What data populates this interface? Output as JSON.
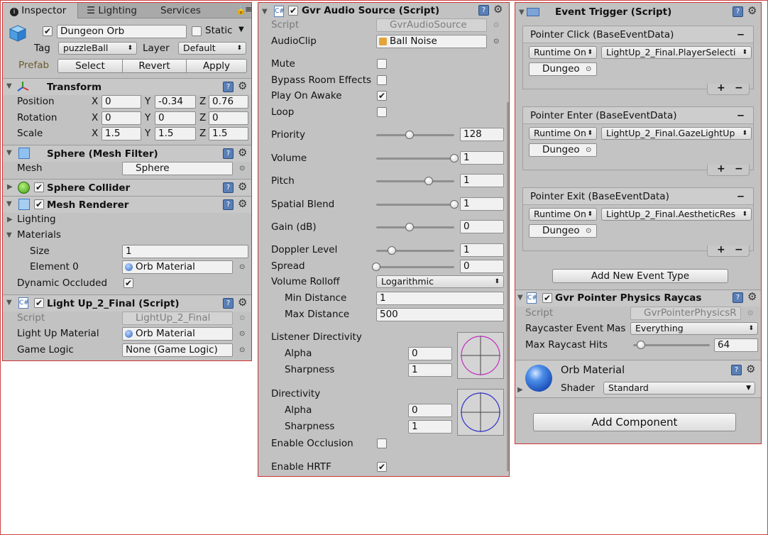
{
  "tabs": {
    "inspector": "Inspector",
    "lighting": "Lighting",
    "services": "Services"
  },
  "object": {
    "name": "Dungeon Orb",
    "static_label": "Static",
    "tag_label": "Tag",
    "tag_value": "puzzleBall",
    "layer_label": "Layer",
    "layer_value": "Default",
    "prefab_label": "Prefab",
    "select": "Select",
    "revert": "Revert",
    "apply": "Apply"
  },
  "transform": {
    "title": "Transform",
    "position": "Position",
    "rotation": "Rotation",
    "scale": "Scale",
    "pos": [
      "0",
      "-0.34",
      "0.76"
    ],
    "rot": [
      "0",
      "0",
      "0"
    ],
    "scl": [
      "1.5",
      "1.5",
      "1.5"
    ],
    "x": "X",
    "y": "Y",
    "z": "Z"
  },
  "mesh_filter": {
    "title": "Sphere (Mesh Filter)",
    "mesh_label": "Mesh",
    "mesh_value": "Sphere"
  },
  "collider": {
    "title": "Sphere Collider"
  },
  "mesh_renderer": {
    "title": "Mesh Renderer",
    "lighting": "Lighting",
    "materials": "Materials",
    "size_label": "Size",
    "size_value": "1",
    "element_label": "Element 0",
    "element_value": "Orb Material",
    "dyn_label": "Dynamic Occluded"
  },
  "lightup": {
    "title": "Light Up_2_Final (Script)",
    "script_label": "Script",
    "script_value": "LightUp_2_Final",
    "material_label": "Light Up Material",
    "material_value": "Orb Material",
    "logic_label": "Game Logic",
    "logic_value": "None (Game Logic)"
  },
  "audio": {
    "title": "Gvr Audio Source (Script)",
    "script_label": "Script",
    "script_value": "GvrAudioSource",
    "clip_label": "AudioClip",
    "clip_value": "Ball Noise",
    "mute": "Mute",
    "bypass": "Bypass Room Effects",
    "play_on_awake": "Play On Awake",
    "loop": "Loop",
    "priority_label": "Priority",
    "priority": "128",
    "priority_level": 0.43,
    "volume_label": "Volume",
    "volume": "1",
    "volume_level": 1.0,
    "pitch_label": "Pitch",
    "pitch": "1",
    "pitch_level": 0.67,
    "spatial_label": "Spatial Blend",
    "spatial": "1",
    "spatial_level": 1.0,
    "gain_label": "Gain (dB)",
    "gain": "0",
    "gain_level": 0.43,
    "doppler_label": "Doppler Level",
    "doppler": "1",
    "doppler_level": 0.2,
    "spread_label": "Spread",
    "spread": "0",
    "spread_level": 0.0,
    "rolloff_label": "Volume Rolloff",
    "rolloff_value": "Logarithmic",
    "min_label": "Min Distance",
    "min_value": "1",
    "max_label": "Max Distance",
    "max_value": "500",
    "listener_label": "Listener Directivity",
    "alpha_label": "Alpha",
    "sharp_label": "Sharpness",
    "listener_alpha": "0",
    "listener_sharp": "1",
    "dir_label": "Directivity",
    "dir_alpha": "0",
    "dir_sharp": "1",
    "occlusion_label": "Enable Occlusion",
    "hrtf_label": "Enable HRTF"
  },
  "event_trigger": {
    "title": "Event Trigger (Script)",
    "events": [
      {
        "title": "Pointer Click (BaseEventData)",
        "mode": "Runtime On",
        "func": "LightUp_2_Final.PlayerSelecti",
        "obj": "Dungeo"
      },
      {
        "title": "Pointer Enter (BaseEventData)",
        "mode": "Runtime On",
        "func": "LightUp_2_Final.GazeLightUp",
        "obj": "Dungeo"
      },
      {
        "title": "Pointer Exit (BaseEventData)",
        "mode": "Runtime On",
        "func": "LightUp_2_Final.AestheticRes",
        "obj": "Dungeo"
      }
    ],
    "add_event": "Add New Event Type"
  },
  "raycaster": {
    "title": "Gvr Pointer Physics Raycas",
    "script_label": "Script",
    "script_value": "GvrPointerPhysicsR",
    "mask_label": "Raycaster Event Mas",
    "mask_value": "Everything",
    "hits_label": "Max Raycast Hits",
    "hits_value": "64",
    "hits_level": 0.1
  },
  "material": {
    "name": "Orb Material",
    "shader_label": "Shader",
    "shader_value": "Standard"
  },
  "add_component": "Add Component",
  "colors": {
    "panel": "#c2c2c2",
    "accent_blue": "#1f5fbf",
    "border_red": "#c33"
  }
}
